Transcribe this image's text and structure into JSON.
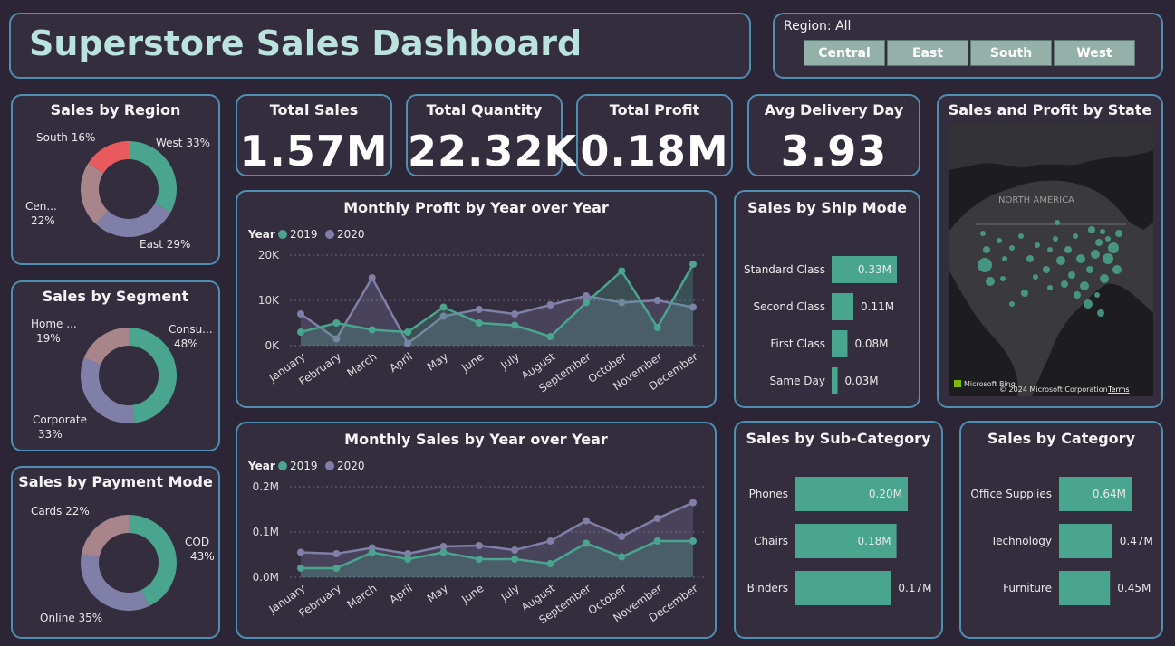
{
  "dashboard": {
    "title": "Superstore Sales Dashboard"
  },
  "slicer": {
    "label": "Region: All",
    "buttons": [
      "Central",
      "East",
      "South",
      "West"
    ]
  },
  "kpis": [
    {
      "label": "Total Sales",
      "value": "1.57M"
    },
    {
      "label": "Total Quantity",
      "value": "22.32K"
    },
    {
      "label": "Total Profit",
      "value": "0.18M"
    },
    {
      "label": "Avg Delivery Day",
      "value": "3.93"
    }
  ],
  "colors": {
    "teal": "#4aa58f",
    "purple": "#7f7fa8",
    "rose": "#a8858a",
    "red": "#e85a5d"
  },
  "map": {
    "title": "Sales and Profit by State",
    "region_label": "NORTH AMERICA",
    "brand": "Microsoft Bing",
    "copyright": "© 2024 Microsoft Corporation",
    "terms": "Terms"
  },
  "chart_data": [
    {
      "type": "pie",
      "donut": true,
      "title": "Sales by Region",
      "slices": [
        {
          "name": "West",
          "value": 33,
          "color": "#4aa58f",
          "label1": "West 33%",
          "label2": ""
        },
        {
          "name": "East",
          "value": 29,
          "color": "#7f7fa8",
          "label1": "East 29%",
          "label2": ""
        },
        {
          "name": "Central",
          "value": 22,
          "color": "#a8858a",
          "label1": "Cen...",
          "label2": "22%"
        },
        {
          "name": "South",
          "value": 16,
          "color": "#e85a5d",
          "label1": "South 16%",
          "label2": ""
        }
      ]
    },
    {
      "type": "pie",
      "donut": true,
      "title": "Sales by Segment",
      "slices": [
        {
          "name": "Consumer",
          "value": 48,
          "color": "#4aa58f",
          "label1": "Consu...",
          "label2": "48%"
        },
        {
          "name": "Corporate",
          "value": 33,
          "color": "#7f7fa8",
          "label1": "Corporate",
          "label2": "33%"
        },
        {
          "name": "Home Office",
          "value": 19,
          "color": "#a8858a",
          "label1": "Home ...",
          "label2": "19%"
        }
      ]
    },
    {
      "type": "pie",
      "donut": true,
      "title": "Sales by Payment Mode",
      "slices": [
        {
          "name": "COD",
          "value": 43,
          "color": "#4aa58f",
          "label1": "COD",
          "label2": "43%"
        },
        {
          "name": "Online",
          "value": 35,
          "color": "#7f7fa8",
          "label1": "Online 35%",
          "label2": ""
        },
        {
          "name": "Cards",
          "value": 22,
          "color": "#a8858a",
          "label1": "Cards 22%",
          "label2": ""
        }
      ]
    },
    {
      "type": "area",
      "title": "Monthly Profit by Year over Year",
      "legend_title": "Year",
      "categories": [
        "January",
        "February",
        "March",
        "April",
        "May",
        "June",
        "July",
        "August",
        "September",
        "October",
        "November",
        "December"
      ],
      "series": [
        {
          "name": "2019",
          "color": "#4aa58f",
          "values": [
            3000,
            5000,
            3500,
            3000,
            8500,
            5000,
            4500,
            2000,
            9500,
            16500,
            4000,
            18000
          ]
        },
        {
          "name": "2020",
          "color": "#7f7fa8",
          "values": [
            7000,
            1500,
            15000,
            500,
            6500,
            8000,
            7000,
            9000,
            11000,
            9500,
            10000,
            8500
          ]
        }
      ],
      "yticks": [
        "0K",
        "10K",
        "20K"
      ],
      "ymax": 20000
    },
    {
      "type": "area",
      "title": "Monthly Sales by Year over Year",
      "legend_title": "Year",
      "categories": [
        "January",
        "February",
        "March",
        "April",
        "May",
        "June",
        "July",
        "August",
        "September",
        "October",
        "November",
        "December"
      ],
      "series": [
        {
          "name": "2019",
          "color": "#4aa58f",
          "values": [
            0.02,
            0.02,
            0.055,
            0.04,
            0.055,
            0.04,
            0.04,
            0.03,
            0.075,
            0.045,
            0.08,
            0.08
          ]
        },
        {
          "name": "2020",
          "color": "#7f7fa8",
          "values": [
            0.055,
            0.052,
            0.065,
            0.052,
            0.068,
            0.07,
            0.06,
            0.08,
            0.125,
            0.09,
            0.13,
            0.165
          ]
        }
      ],
      "yticks": [
        "0.0M",
        "0.1M",
        "0.2M"
      ],
      "ymax": 0.2
    },
    {
      "type": "bar",
      "orientation": "horizontal",
      "title": "Sales by Ship Mode",
      "categories": [
        "Standard Class",
        "Second Class",
        "First Class",
        "Same Day"
      ],
      "values": [
        0.33,
        0.11,
        0.08,
        0.03
      ],
      "labels": [
        "0.33M",
        "0.11M",
        "0.08M",
        "0.03M"
      ]
    },
    {
      "type": "bar",
      "orientation": "horizontal",
      "title": "Sales by Sub-Category",
      "categories": [
        "Phones",
        "Chairs",
        "Binders"
      ],
      "values": [
        0.2,
        0.18,
        0.17
      ],
      "labels": [
        "0.20M",
        "0.18M",
        "0.17M"
      ]
    },
    {
      "type": "bar",
      "orientation": "horizontal",
      "title": "Sales by Category",
      "categories": [
        "Office Supplies",
        "Technology",
        "Furniture"
      ],
      "values": [
        0.64,
        0.47,
        0.45
      ],
      "labels": [
        "0.64M",
        "0.47M",
        "0.45M"
      ]
    }
  ]
}
